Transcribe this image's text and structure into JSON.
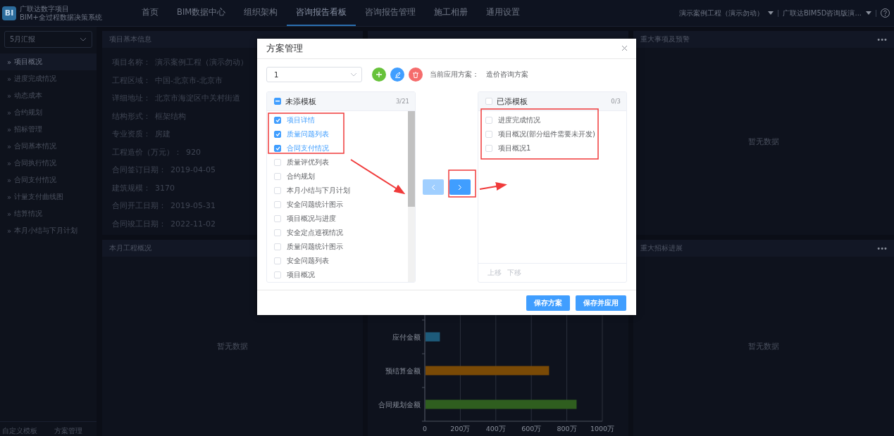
{
  "header": {
    "logo_mark": "BI",
    "title": "广联达数字项目",
    "subtitle": "BIM+全过程数据决策系统",
    "nav": [
      {
        "label": "首页",
        "selected": false
      },
      {
        "label": "BIM数据中心",
        "selected": false
      },
      {
        "label": "组织架构",
        "selected": false
      },
      {
        "label": "咨询报告看板",
        "selected": true
      },
      {
        "label": "咨询报告管理",
        "selected": false
      },
      {
        "label": "施工相册",
        "selected": false
      },
      {
        "label": "通用设置",
        "selected": false
      }
    ],
    "project_select": "演示案例工程（演示勿动）",
    "org_select": "广联达BIM5D咨询版演..."
  },
  "sidebar": {
    "report_select": "5月汇报",
    "items": [
      {
        "marker": "»",
        "label": "项目概况",
        "selected": true
      },
      {
        "marker": "»",
        "label": "进度完成情况",
        "selected": false
      },
      {
        "marker": "»",
        "label": "动态成本",
        "selected": false
      },
      {
        "marker": "»",
        "label": "合约规划",
        "selected": false
      },
      {
        "marker": "»",
        "label": "招标管理",
        "selected": false
      },
      {
        "marker": "»",
        "label": "合同基本情况",
        "selected": false
      },
      {
        "marker": "»",
        "label": "合同执行情况",
        "selected": false
      },
      {
        "marker": "»",
        "label": "合同支付情况",
        "selected": false
      },
      {
        "marker": "»",
        "label": "计量支付曲线图",
        "selected": false
      },
      {
        "marker": "»",
        "label": "结算情况",
        "selected": false
      },
      {
        "marker": "»",
        "label": "本月小结与下月计划",
        "selected": false
      }
    ],
    "footer": [
      "自定义模板",
      "方案管理"
    ]
  },
  "panels": [
    {
      "kind": "info",
      "title": "项目基本信息",
      "fields": [
        {
          "label": "项目名称：",
          "value": "演示案例工程（演示勿动）"
        },
        {
          "label": "工程区域：",
          "value": "中国-北京市-北京市"
        },
        {
          "label": "详细地址：",
          "value": "北京市海淀区中关村街道"
        },
        {
          "label": "结构形式：",
          "value": "框架结构"
        },
        {
          "label": "专业资质：",
          "value": "房建"
        },
        {
          "label": "工程造价（万元）：",
          "value": "920"
        },
        {
          "label": "合同签订日期：",
          "value": "2019-04-05"
        },
        {
          "label": "建筑规模：",
          "value": "3170"
        },
        {
          "label": "合同开工日期：",
          "value": "2019-05-31"
        },
        {
          "label": "合同竣工日期：",
          "value": "2022-11-02"
        }
      ]
    },
    {
      "kind": "blank"
    },
    {
      "kind": "empty",
      "title": "重大事项及预警",
      "menu": "•••",
      "empty_text": "暂无数据"
    },
    {
      "kind": "empty",
      "title": "本月工程概况",
      "empty_text": "暂无数据"
    },
    {
      "kind": "chart",
      "chart_data": {
        "type": "bar",
        "orientation": "horizontal",
        "categories": [
          "应付金额",
          "预结算金额",
          "合同规划金额"
        ],
        "values": [
          85,
          700,
          855
        ],
        "colors": [
          "#1d5a7a",
          "#7a4a06",
          "#2f5e1f"
        ],
        "grid": true,
        "xlim": [
          0,
          1000
        ],
        "xticks": [
          {
            "value": 0,
            "label": "0"
          },
          {
            "value": 200,
            "label": "200万"
          },
          {
            "value": 400,
            "label": "400万"
          },
          {
            "value": 600,
            "label": "600万"
          },
          {
            "value": 800,
            "label": "800万"
          },
          {
            "value": 1000,
            "label": "1000万"
          }
        ]
      }
    },
    {
      "kind": "empty",
      "title": "重大招标进展",
      "menu": "•••",
      "empty_text": "暂无数据"
    }
  ],
  "dialog": {
    "title": "方案管理",
    "scheme_select": "1",
    "current_label": "当前应用方案：",
    "current_value": "造价咨询方案",
    "source": {
      "title": "未添模板",
      "count": "3/21",
      "indeterminate": true,
      "items": [
        {
          "label": "项目详情",
          "checked": true
        },
        {
          "label": "质量问题列表",
          "checked": true
        },
        {
          "label": "合同支付情况",
          "checked": true
        },
        {
          "label": "质量评优列表",
          "checked": false
        },
        {
          "label": "合约规划",
          "checked": false
        },
        {
          "label": "本月小结与下月计划",
          "checked": false
        },
        {
          "label": "安全问题统计图示",
          "checked": false
        },
        {
          "label": "项目概况与进度",
          "checked": false
        },
        {
          "label": "安全定点巡视情况",
          "checked": false
        },
        {
          "label": "质量问题统计图示",
          "checked": false
        },
        {
          "label": "安全问题列表",
          "checked": false
        },
        {
          "label": "项目概况",
          "checked": false
        }
      ]
    },
    "move_left": {
      "disabled": true
    },
    "move_right": {
      "disabled": false
    },
    "target": {
      "title": "已添模板",
      "count": "0/3",
      "checked": false,
      "indeterminate": false,
      "items": [
        {
          "label": "进度完成情况",
          "checked": false
        },
        {
          "label": "项目概况(部分组件需要未开发)",
          "checked": false
        },
        {
          "label": "项目概况1",
          "checked": false
        }
      ],
      "footer": [
        "上移",
        "下移"
      ]
    },
    "buttons": [
      "保存方案",
      "保存并应用"
    ]
  }
}
